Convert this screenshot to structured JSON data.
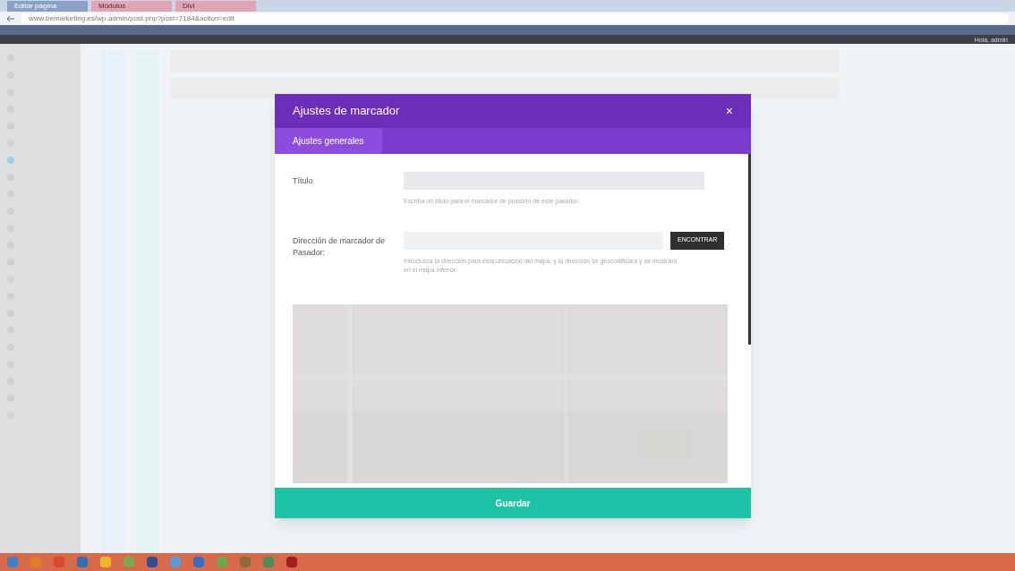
{
  "browser": {
    "tabs": [
      {
        "label": "Editar página",
        "selected": true
      },
      {
        "label": "Módulos",
        "selected": false
      },
      {
        "label": "Divi",
        "selected": false
      }
    ],
    "url": "www.bemarketing.es/wp-admin/post.php?post=7184&action=edit"
  },
  "admin_bar": {
    "greeting": "Hola, admin"
  },
  "modal": {
    "title": "Ajustes de marcador",
    "close": "×",
    "tabs": [
      {
        "label": "Ajustes generales",
        "selected": true
      }
    ],
    "fields": [
      {
        "kind": "text",
        "label": "Título",
        "help": "Escriba un título para el marcador de posición de este pasador."
      },
      {
        "kind": "address",
        "label": "Dirección de marcador de Pasador:",
        "button": "ENCONTRAR",
        "help": "Introduzca la dirección para esta ubicación del mapa, y la dirección se geocodificará y se mostrará en el mapa inferior."
      }
    ],
    "save": "Guardar"
  }
}
